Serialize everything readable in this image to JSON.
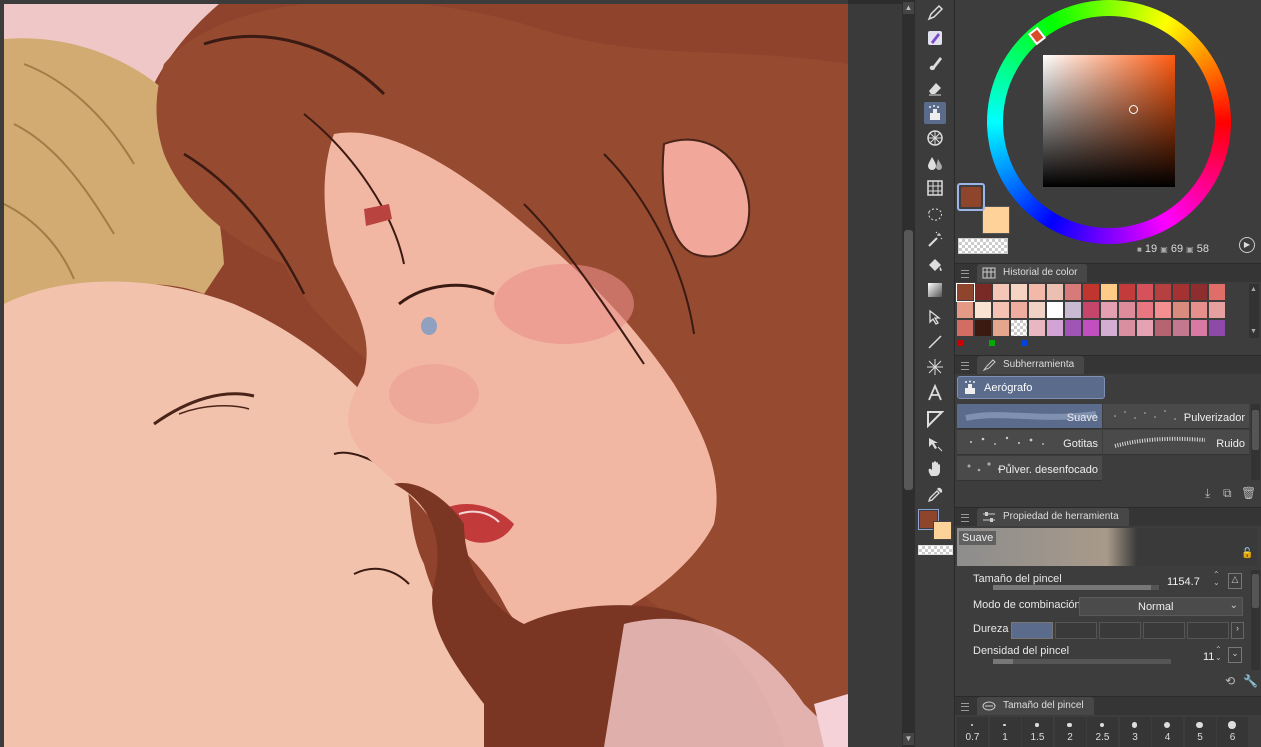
{
  "colors": {
    "main": "#8e452b",
    "sub": "#ffd299",
    "accent": "#5b6b8c",
    "panel": "#3d3d3d"
  },
  "color_wheel": {
    "h_value": "19",
    "s_value": "69",
    "v_value": "58"
  },
  "color_history": {
    "title": "Historial de color",
    "rows": [
      [
        "#8e452b",
        "#7a2a26",
        "#f3c6b8",
        "#f6d4c4",
        "#f2b9a8",
        "#ecc0b0",
        "#d97a7a",
        "#c0362f",
        "#ffcc88",
        "#c33b3b",
        "#d7515a",
        "#b6403f",
        "#a43232",
        "#8e2d2d",
        "#df6e68"
      ],
      [
        "#e59a86",
        "#fbe3d4",
        "#f5c1b2",
        "#efad9f",
        "#f3d2c6",
        "#ffffff",
        "#c9bad3",
        "#c6456b",
        "#e49fb2",
        "#de8c9b",
        "#e97782",
        "#f38f91",
        "#d98c7d",
        "#e6908d",
        "#e7a0a0"
      ],
      [
        "#d26d64",
        "#3b1a12",
        "#e4a78e",
        "#checker",
        "#e8b7c2",
        "#d3a3d6",
        "#a055b6",
        "#c24fc0",
        "#d4aed2",
        "#d98fa0",
        "#e5a2b3",
        "#b66470",
        "#c3788f",
        "#d87aa4",
        "#8e4aa8"
      ]
    ],
    "indicators": [
      "#cc0000",
      "#00aa00",
      "#0044dd"
    ]
  },
  "subtool": {
    "title": "Subherramienta",
    "group": "Aerógrafo",
    "brushes": [
      {
        "name": "Suave"
      },
      {
        "name": "Pulverizador"
      },
      {
        "name": "Gotitas"
      },
      {
        "name": "Ruido"
      },
      {
        "name": "Pulver. desenfocado"
      }
    ]
  },
  "tool_property": {
    "title": "Propiedad de herramienta",
    "preset_name": "Suave",
    "brush_size_label": "Tamaño del pincel",
    "brush_size_value": "1154.7",
    "brush_size_fraction": 0.95,
    "blend_label": "Modo de combinación",
    "blend_value": "Normal",
    "hardness_label": "Dureza",
    "hardness_level": 1,
    "density_label": "Densidad del pincel",
    "density_value": "11",
    "density_fraction": 0.11
  },
  "brush_size_panel": {
    "title": "Tamaño del pincel",
    "sizes": [
      "0.7",
      "1",
      "1.5",
      "2",
      "2.5",
      "3",
      "4",
      "5",
      "6"
    ]
  }
}
